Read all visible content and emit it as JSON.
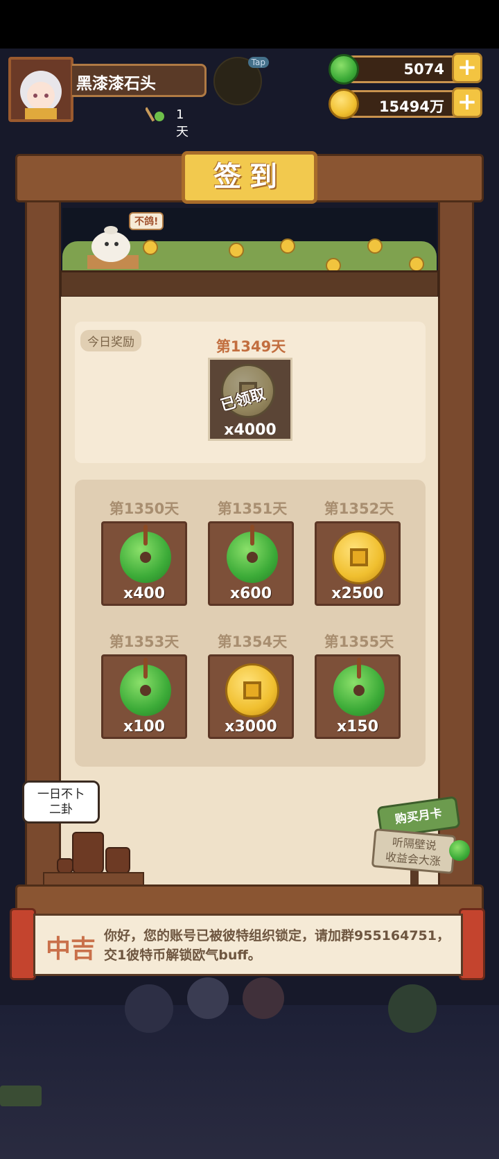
{
  "player": {
    "name": "黑漆漆石头",
    "days": "1天",
    "avatar_icon": "girl-avatar-icon"
  },
  "top_button": {
    "label": "Tap"
  },
  "currency": {
    "jade": {
      "value": "5074",
      "icon": "jade-icon"
    },
    "coin": {
      "value": "15494万",
      "icon": "coin-icon"
    }
  },
  "board": {
    "title": "签到",
    "bird_speech": "不鸽!",
    "today_tag": "今日奖励"
  },
  "today": {
    "day_label": "第1349天",
    "reward_type": "coin",
    "amount": "x4000",
    "status": "已领取"
  },
  "upcoming": [
    {
      "day_label": "第1350天",
      "reward_type": "jade",
      "amount": "x400"
    },
    {
      "day_label": "第1351天",
      "reward_type": "jade",
      "amount": "x600"
    },
    {
      "day_label": "第1352天",
      "reward_type": "coin",
      "amount": "x2500"
    },
    {
      "day_label": "第1353天",
      "reward_type": "jade",
      "amount": "x100"
    },
    {
      "day_label": "第1354天",
      "reward_type": "coin",
      "amount": "x3000"
    },
    {
      "day_label": "第1355天",
      "reward_type": "jade",
      "amount": "x150"
    }
  ],
  "speech_bubble": {
    "line1": "一日不卜",
    "line2": "二卦"
  },
  "monthly_sign": {
    "title": "购买月卡",
    "line1": "听隔壁说",
    "line2": "收益会大涨"
  },
  "fortune": {
    "level": "中吉",
    "message": "你好，您的账号已被彼特组织锁定，请加群955164751，交1彼特币解锁欧气buff。"
  },
  "colors": {
    "wood": "#7a4a2e",
    "gold": "#f2c94e",
    "jade": "#3cab38",
    "highlight_text": "#c26e3f"
  }
}
